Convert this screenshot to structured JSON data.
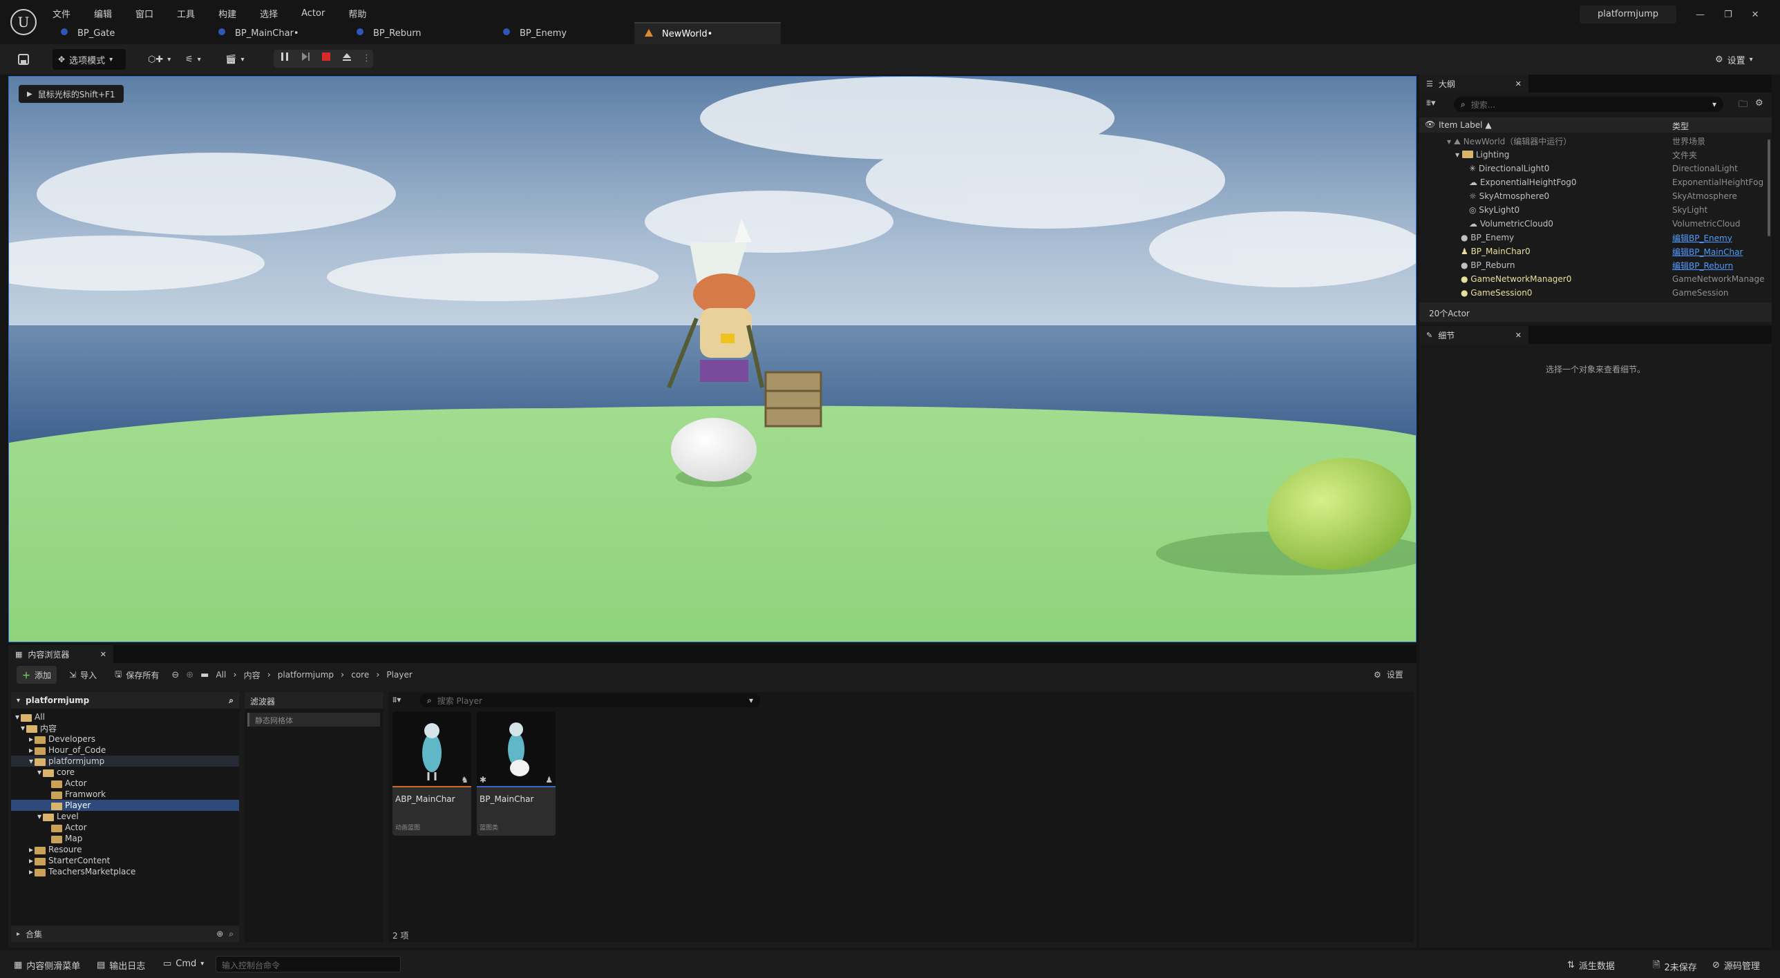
{
  "menu": [
    "文件",
    "编辑",
    "窗口",
    "工具",
    "构建",
    "选择",
    "Actor",
    "帮助"
  ],
  "project_name": "platformjump",
  "doc_tabs": [
    {
      "label": "BP_Gate"
    },
    {
      "label": "BP_MainChar•"
    },
    {
      "label": "BP_Reburn"
    },
    {
      "label": "BP_Enemy"
    },
    {
      "label": "NewWorld•"
    }
  ],
  "toolbar": {
    "mode_label": "选项模式",
    "settings_label": "设置"
  },
  "viewport": {
    "hint": "鼠标光标的Shift+F1"
  },
  "outliner": {
    "tab_title": "大纲",
    "search_placeholder": "搜索...",
    "col_label": "Item Label ▲",
    "col_type": "类型",
    "rows": [
      {
        "label": "NewWorld（编辑器中运行）",
        "type": "世界场景"
      },
      {
        "label": "Lighting",
        "type": "文件夹"
      },
      {
        "label": "DirectionalLight0",
        "type": "DirectionalLight"
      },
      {
        "label": "ExponentialHeightFog0",
        "type": "ExponentialHeightFog"
      },
      {
        "label": "SkyAtmosphere0",
        "type": "SkyAtmosphere"
      },
      {
        "label": "SkyLight0",
        "type": "SkyLight"
      },
      {
        "label": "VolumetricCloud0",
        "type": "VolumetricCloud"
      },
      {
        "label": "BP_Enemy",
        "type": "编辑BP_Enemy"
      },
      {
        "label": "BP_MainChar0",
        "type": "编辑BP_MainChar"
      },
      {
        "label": "BP_Reburn",
        "type": "编辑BP_Reburn"
      },
      {
        "label": "GameNetworkManager0",
        "type": "GameNetworkManager"
      },
      {
        "label": "GameSession0",
        "type": "GameSession"
      }
    ],
    "count": "20个Actor"
  },
  "details": {
    "tab_title": "细节",
    "empty_msg": "选择一个对象来查看细节。"
  },
  "content_browser": {
    "tab_title": "内容浏览器",
    "add_label": "添加",
    "import_label": "导入",
    "save_all_label": "保存所有",
    "breadcrumb": [
      "All",
      "内容",
      "platformjump",
      "core",
      "Player"
    ],
    "settings_label": "设置",
    "source_title": "platformjump",
    "tree": [
      {
        "label": "All"
      },
      {
        "label": "内容"
      },
      {
        "label": "Developers"
      },
      {
        "label": "Hour_of_Code"
      },
      {
        "label": "platformjump"
      },
      {
        "label": "core"
      },
      {
        "label": "Actor"
      },
      {
        "label": "Framwork"
      },
      {
        "label": "Player"
      },
      {
        "label": "Level"
      },
      {
        "label": "Actor"
      },
      {
        "label": "Map"
      },
      {
        "label": "Resoure"
      },
      {
        "label": "StarterContent"
      },
      {
        "label": "TeachersMarketplace"
      }
    ],
    "collections_label": "合集",
    "filters_title": "滤波器",
    "filter_chip": "静态网格体",
    "search_placeholder": "搜索 Player",
    "assets": [
      {
        "name": "ABP_MainChar",
        "type": "动画蓝图"
      },
      {
        "name": "BP_MainChar",
        "type": "蓝图类"
      }
    ],
    "item_count": "2 项"
  },
  "statusbar": {
    "drawer": "内容侧滑菜单",
    "output_log": "输出日志",
    "cmd": "Cmd",
    "console_placeholder": "输入控制台命令",
    "derived_data": "派生数据",
    "unsaved": "2未保存",
    "source_control": "源码管理"
  }
}
